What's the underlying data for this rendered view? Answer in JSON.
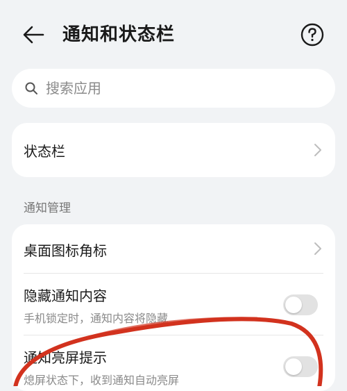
{
  "header": {
    "title": "通知和状态栏"
  },
  "search": {
    "placeholder": "搜索应用"
  },
  "status_card": {
    "label": "状态栏"
  },
  "section": {
    "title": "通知管理"
  },
  "notif_card": {
    "items": [
      {
        "label": "桌面图标角标",
        "type": "link"
      },
      {
        "label": "隐藏通知内容",
        "sub": "手机锁定时，通知内容将隐藏",
        "type": "toggle",
        "on": false
      },
      {
        "label": "通知亮屏提示",
        "sub": "熄屏状态下，收到通知自动亮屏",
        "type": "toggle",
        "on": false
      }
    ]
  },
  "colors": {
    "background": "#f1f3f5",
    "card": "#ffffff",
    "annotation": "#d2321e"
  }
}
